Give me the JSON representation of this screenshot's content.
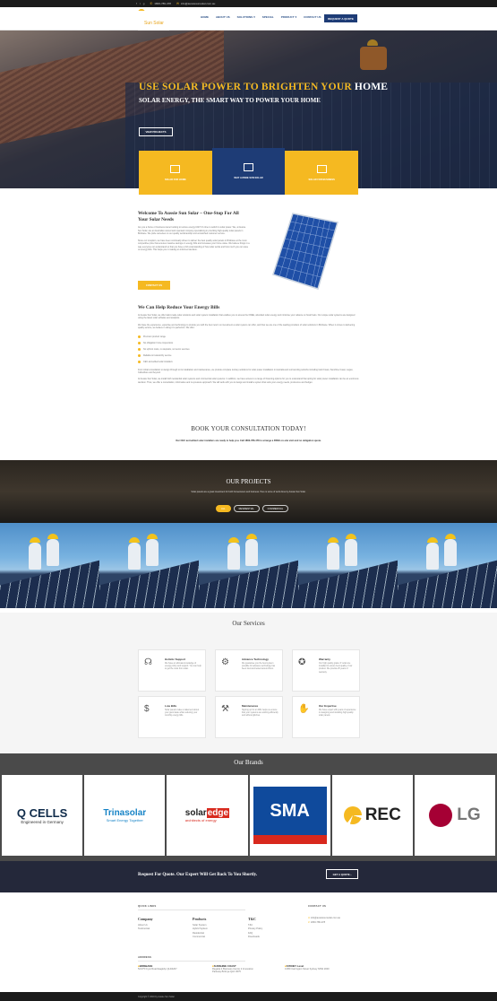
{
  "topbar": {
    "phone": "1800-786-478",
    "email": "info@aussiesunsolar.com.au"
  },
  "logo": {
    "brand": "AUSSIE",
    "sub": "Sun Solar"
  },
  "nav": {
    "items": [
      "HOME",
      "ABOUT US",
      "SOLUTIONS",
      "SPECIAL",
      "PRODUCT",
      "CONTACT US"
    ],
    "cta": "REQUEST A QUOTE"
  },
  "hero": {
    "headline_accent": "USE SOLAR POWER TO BRIGHTEN YOUR",
    "headline_end": "HOME",
    "subheadline": "SOLAR ENERGY, THE SMART WAY TO POWER YOUR HOME",
    "button": "VIEW PROJECTS"
  },
  "tiles": [
    "SOLAR FOR HOME",
    "WHY AUSSIE SUN SOLAR",
    "SOLAR FOR BUSINESS"
  ],
  "welcome": {
    "title": "Welcome To Aussie Sun Solar – One-Stop For All Your Solar Needs",
    "p1": "Are you a home or business owner looking to reduce energy bills? It’s time to switch to solar power. We, at Aussie Sun Solar, are an Australian owned and operated company specialising in providing high-quality solar panels in Brisbane. We pride ourselves on our quality workmanship and unmatched customer service.",
    "p2": "Since our inception, we have been continually driven to deliver the best quality solar panels in Brisbane at the most competitive price that ensures massive savings on energy bills and increases your home value. We believe things in a way everyone can understand so that you have a full understanding of how solar works and how much you can save on energy bills. This helps you in making an informed decision.",
    "button": "CONTACT US"
  },
  "energy": {
    "title": "We Can Help Reduce Your Energy Bills",
    "p1": "At Aussie Sun Solar, we offer tailor-made solar solutions and solar system installation that enables you to access the FREE, abundant solar energy and minimise your reliance on fossil fuels. Our unique solar systems are designed using the latest solar software and analytics.",
    "p2": "We have the experience, expertise and technology to provide you with the best return on investment a solar system can offer, and thus we are one of the leading providers of solar solutions in Brisbane. When it comes to delivering quality service, we believe in doing it to perfection. We offer:",
    "list": [
      "Premium product range",
      "No obligation home inspections",
      "No upfront costs, no deposits, no tied-in services",
      "Reliable & trustworthy service",
      "CEC accredited solar installers"
    ],
    "p3": "From initial consultation to design through to its installation and maintenance, we provide complete turnkey solutions for solar power installation in Australia and surrounding suburbs including Gold Coast, Sunshine Coast, Logan, Caboolture and beyond.",
    "p4": "At Aussie Sun Solar, we install both residential solar systems and commercial solar systems. In addition, we have access to a range of financing options for you to understand that opting for solar power installation can be an enormous decision. Thus, we offer a consultation, informative and no-pressure approach. We will work with you to design and install a system that suits your energy needs, preference and budget."
  },
  "book": {
    "title": "BOOK YOUR CONSULTATION TODAY!",
    "text": "Our CEC accredited solar installers are ready to help you. Call 1800-786-478 to arrange a FREE on-site visit and no obligation quote."
  },
  "projects": {
    "title": "OUR PROJECTS",
    "subtitle": "Solar panels are a great investment for both homeowners and business. Here is some of work done by Aussie Sun Solar.",
    "filters": [
      "ALL",
      "RESIDENTIAL",
      "COMMERCIAL"
    ]
  },
  "services": {
    "title": "Our Services",
    "items": [
      {
        "icon": "headset-icon",
        "title": "Holistic Support",
        "desc": "We have an ultimate knowledge of energy policy and support. You can help to get the most from solar."
      },
      {
        "icon": "tech-hand-icon",
        "title": "Advance Technology",
        "desc": "We guarantee you the best system possible for advance technology has been tried and tested around them."
      },
      {
        "icon": "warranty-medal-icon",
        "title": "Warranty",
        "desc": "Our high quality grade 'A' solar are installed to ensure best quality of our product. We provide 25 years of warranty."
      },
      {
        "icon": "low-bills-icon",
        "title": "Low Bills",
        "desc": "Solar panels make a statement about your good taste while reducing your monthly energy bills."
      },
      {
        "icon": "maintenance-tools-icon",
        "title": "Maintenance",
        "desc": "Signing up for an MFL helps us ensure that your systems are working efficiently and without glitches."
      },
      {
        "icon": "expertise-icon",
        "title": "Our Expertise",
        "desc": "We have expert with years of experience in designing and installing high quality solar panels."
      }
    ]
  },
  "brands": {
    "title": "Our Brands",
    "qcells": "Q CELLS",
    "qcells_sub": "Engineered in Germany",
    "trina": "Trinasolar",
    "trina_sub": "Smart Energy Together",
    "solaredge_a": "solar",
    "solaredge_b": "edge",
    "solaredge_sub": "architects of energy",
    "sma": "SMA",
    "rec": "REC",
    "lg": "LG"
  },
  "cta": {
    "text": "Request For Quote. Our Expert Will Get Back To You Shortly.",
    "button": "GET A QUOTE"
  },
  "footer": {
    "quick_links": "QUICK LINKS",
    "contact_us": "CONTACT US",
    "company": {
      "title": "Company",
      "links": [
        "About Us",
        "Testimonial"
      ]
    },
    "products": {
      "title": "Products",
      "links": [
        "Solar System",
        "Hybrid System",
        "Residential",
        "Commercial"
      ]
    },
    "tc": {
      "title": "T&C",
      "links": [
        "T&C",
        "Privacy Policy",
        "FAQ",
        "Downloads"
      ]
    },
    "contact": [
      "info@aussiesunsolar.com.au",
      "1800-786-478"
    ],
    "address_label": "ADDRESS",
    "addresses": [
      {
        "name": "BRISBANE",
        "lines": [
          "52/175 Fryar Road Eagleby QLD4207"
        ]
      },
      {
        "name": "SUNSHINE COAST",
        "lines": [
          "Regatta 2 Business Centre 2 Innovation",
          "Parkway Birtinya QLD 4575"
        ]
      },
      {
        "name": "SYDNEY Level",
        "lines": [
          "13/50 Carrington Street Sydney NSW 2000"
        ]
      }
    ],
    "copyright": "Copyright © 2019 by Aussie Sun Solar"
  }
}
